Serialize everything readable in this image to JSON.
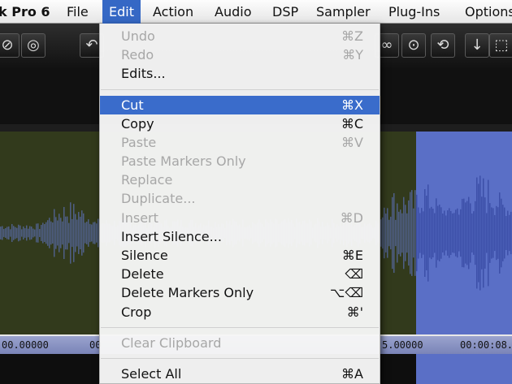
{
  "menubar": {
    "app_name": "k Pro 6",
    "items": [
      "File",
      "Edit",
      "Action",
      "Audio",
      "DSP",
      "Sampler",
      "Plug-Ins",
      "Options"
    ]
  },
  "edit_menu": {
    "items": [
      {
        "label": "Undo",
        "shortcut": "⌘Z",
        "enabled": false
      },
      {
        "label": "Redo",
        "shortcut": "⌘Y",
        "enabled": false
      },
      {
        "label": "Edits...",
        "shortcut": "",
        "enabled": true
      },
      {
        "label": "Cut",
        "shortcut": "⌘X",
        "enabled": true,
        "highlighted": true
      },
      {
        "label": "Copy",
        "shortcut": "⌘C",
        "enabled": true
      },
      {
        "label": "Paste",
        "shortcut": "⌘V",
        "enabled": false
      },
      {
        "label": "Paste Markers Only",
        "shortcut": "",
        "enabled": false
      },
      {
        "label": "Replace",
        "shortcut": "",
        "enabled": false
      },
      {
        "label": "Duplicate...",
        "shortcut": "",
        "enabled": false
      },
      {
        "label": "Insert",
        "shortcut": "⌘D",
        "enabled": false
      },
      {
        "label": "Insert Silence...",
        "shortcut": "",
        "enabled": true
      },
      {
        "label": "Silence",
        "shortcut": "⌘E",
        "enabled": true
      },
      {
        "label": "Delete",
        "shortcut": "⌫",
        "enabled": true
      },
      {
        "label": "Delete Markers Only",
        "shortcut": "⌥⌫",
        "enabled": true
      },
      {
        "label": "Crop",
        "shortcut": "⌘'",
        "enabled": true
      },
      {
        "label": "Clear Clipboard",
        "shortcut": "",
        "enabled": false
      },
      {
        "label": "Select All",
        "shortcut": "⌘A",
        "enabled": true
      }
    ]
  },
  "ruler": {
    "labels": [
      "00.00000",
      "00",
      "5.00000",
      "00:00:08."
    ]
  },
  "toolbar": {
    "icons": [
      "cd-burn-icon",
      "cd-b-icon",
      "undo-arrow-icon",
      "infinity-loop-icon",
      "play-circle-icon",
      "repeat-icon",
      "down-arrow-icon",
      "marquee-select-icon"
    ]
  },
  "colors": {
    "menu_highlight": "#3a6ccb",
    "waveform_bg": "#323a1c",
    "selection": "#5a6fc6"
  }
}
